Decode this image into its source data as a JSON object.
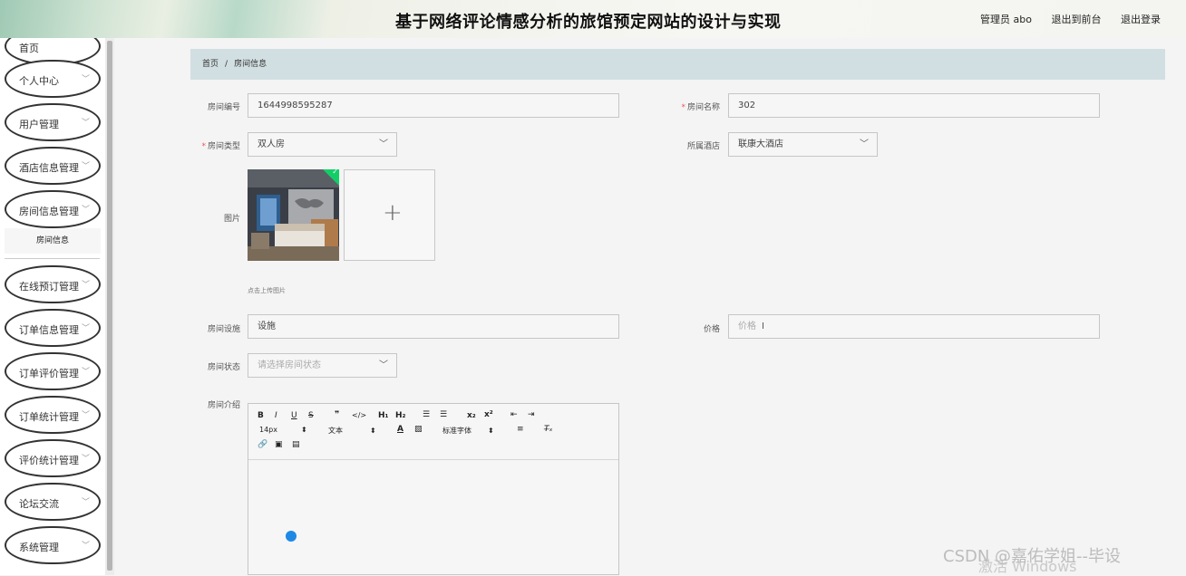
{
  "header": {
    "title": "基于网络评论情感分析的旅馆预定网站的设计与实现",
    "admin": "管理员 abo",
    "frontend_link": "退出到前台",
    "logout_link": "退出登录"
  },
  "sidebar": {
    "items": [
      {
        "label": "首页"
      },
      {
        "label": "个人中心"
      },
      {
        "label": "用户管理"
      },
      {
        "label": "酒店信息管理"
      },
      {
        "label": "房间信息管理"
      },
      {
        "label": "在线预订管理"
      },
      {
        "label": "订单信息管理"
      },
      {
        "label": "订单评价管理"
      },
      {
        "label": "订单统计管理"
      },
      {
        "label": "评价统计管理"
      },
      {
        "label": "论坛交流"
      },
      {
        "label": "系统管理"
      }
    ],
    "sub_item": "房间信息"
  },
  "breadcrumb": {
    "home": "首页",
    "sep": "/",
    "current": "房间信息"
  },
  "form": {
    "room_no": {
      "label": "房间编号",
      "value": "1644998595287"
    },
    "room_name": {
      "label": "房间名称",
      "value": "302"
    },
    "room_type": {
      "label": "房间类型",
      "value": "双人房"
    },
    "hotel": {
      "label": "所属酒店",
      "value": "联康大酒店"
    },
    "picture": {
      "label": "图片",
      "hint": "点击上传图片"
    },
    "facilities": {
      "label": "房间设施",
      "value": "设施"
    },
    "price": {
      "label": "价格",
      "placeholder": "价格"
    },
    "status": {
      "label": "房间状态",
      "placeholder": "请选择房间状态"
    },
    "intro": {
      "label": "房间介绍"
    },
    "editor": {
      "font_size": "14px",
      "paragraph": "文本",
      "font_family": "标准字体"
    }
  },
  "watermarks": {
    "csdn": "CSDN @嘉佑学姐--毕设",
    "windows": "激活 Windows"
  }
}
